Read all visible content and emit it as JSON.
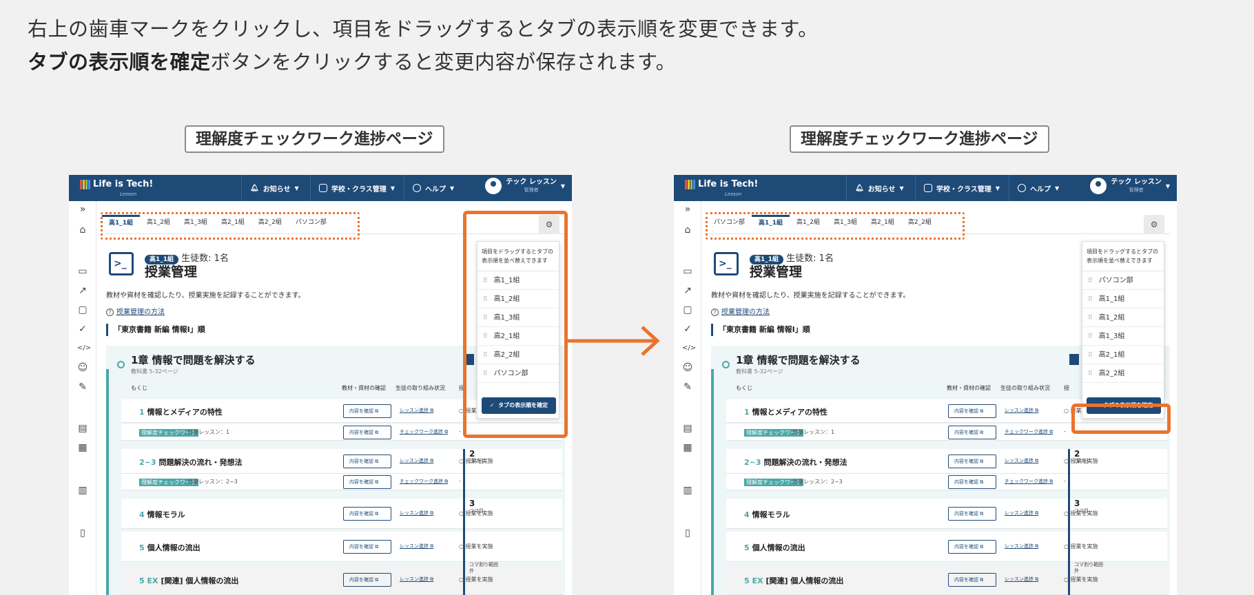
{
  "instructions": {
    "line1": "右上の歯車マークをクリックし、項目をドラッグするとタブの表示順を変更できます。",
    "line2_bold": "タブの表示順を確定",
    "line2_rest": "ボタンをクリックすると変更内容が保存されます。"
  },
  "captions": {
    "left": "理解度チェックワーク進捗ページ",
    "right": "理解度チェックワーク進捗ページ"
  },
  "app": {
    "logo": "Life is Tech!",
    "logo_sub": "Lesson",
    "nav": {
      "notice": "お知らせ",
      "school": "学校・クラス管理",
      "help": "ヘルプ"
    },
    "user_name": "テック レッスン",
    "user_role": "管理者"
  },
  "before": {
    "tabs": [
      "高1_1組",
      "高1_2組",
      "高1_3組",
      "高2_1組",
      "高2_2組",
      "パソコン部"
    ],
    "popup_items": [
      "高1_1組",
      "高1_2組",
      "高1_3組",
      "高2_1組",
      "高2_2組",
      "パソコン部"
    ]
  },
  "after": {
    "tabs": [
      "パソコン部",
      "高1_1組",
      "高1_2組",
      "高1_3組",
      "高2_1組",
      "高2_2組"
    ],
    "popup_items": [
      "パソコン部",
      "高1_1組",
      "高1_2組",
      "高1_3組",
      "高2_1組",
      "高2_2組"
    ]
  },
  "popup": {
    "hint": "項目をドラッグするとタブの表示順を並べ替えできます",
    "confirm": "タブの表示順を確定"
  },
  "page": {
    "class_badge": "高1_1組",
    "student_count": "生徒数: 1名",
    "title": "授業管理",
    "description": "教材や資材を確認したり、授業実施を記録することができます。",
    "howto": "授業管理の方法",
    "section": "「東京書籍 新編 情報Ⅰ」順",
    "chapter_title": "1章 情報で問題を解決する",
    "chapter_sub": "教科書 5-32ページ",
    "col_toc": "もくじ",
    "col_material": "教材・資材の確認",
    "col_progress": "生徒の取り組み状況",
    "col_impl": "授",
    "rows": [
      {
        "num": "1",
        "title": "情報とメディアの特性",
        "btn": "内容を確認",
        "link": "レッスン進捗",
        "impl": "授業を実施"
      },
      {
        "tag": "理解度チェックワーク",
        "target": "対象レッスン：1",
        "btn": "内容を確認",
        "link": "チェックワーク進捗",
        "impl": "-"
      },
      {
        "num": "2~3",
        "title": "問題解決の流れ・発想法",
        "btn": "内容を確認",
        "link": "レッスン進捗",
        "impl": "授業を実施"
      },
      {
        "tag": "理解度チェックワーク",
        "target": "対象レッスン：2~3",
        "btn": "内容を確認",
        "link": "チェックワーク進捗",
        "impl": "-"
      },
      {
        "num": "4",
        "title": "情報モラル",
        "btn": "内容を確認",
        "link": "レッスン進捗",
        "impl": "授業を実施"
      },
      {
        "num": "5",
        "title": "個人情報の流出",
        "btn": "内容を確認",
        "link": "レッスン進捗",
        "impl": "授業を実施"
      },
      {
        "num": "5 EX",
        "title": "[関連] 個人情報の流出",
        "btn": "内容を確認",
        "link": "レッスン進捗",
        "impl": "授業を実施"
      }
    ],
    "koma": [
      {
        "n": "2",
        "unit": "コマ目"
      },
      {
        "n": "3",
        "unit": "コマ目"
      },
      {
        "n": "",
        "unit": "コマ割り範囲外"
      }
    ]
  }
}
